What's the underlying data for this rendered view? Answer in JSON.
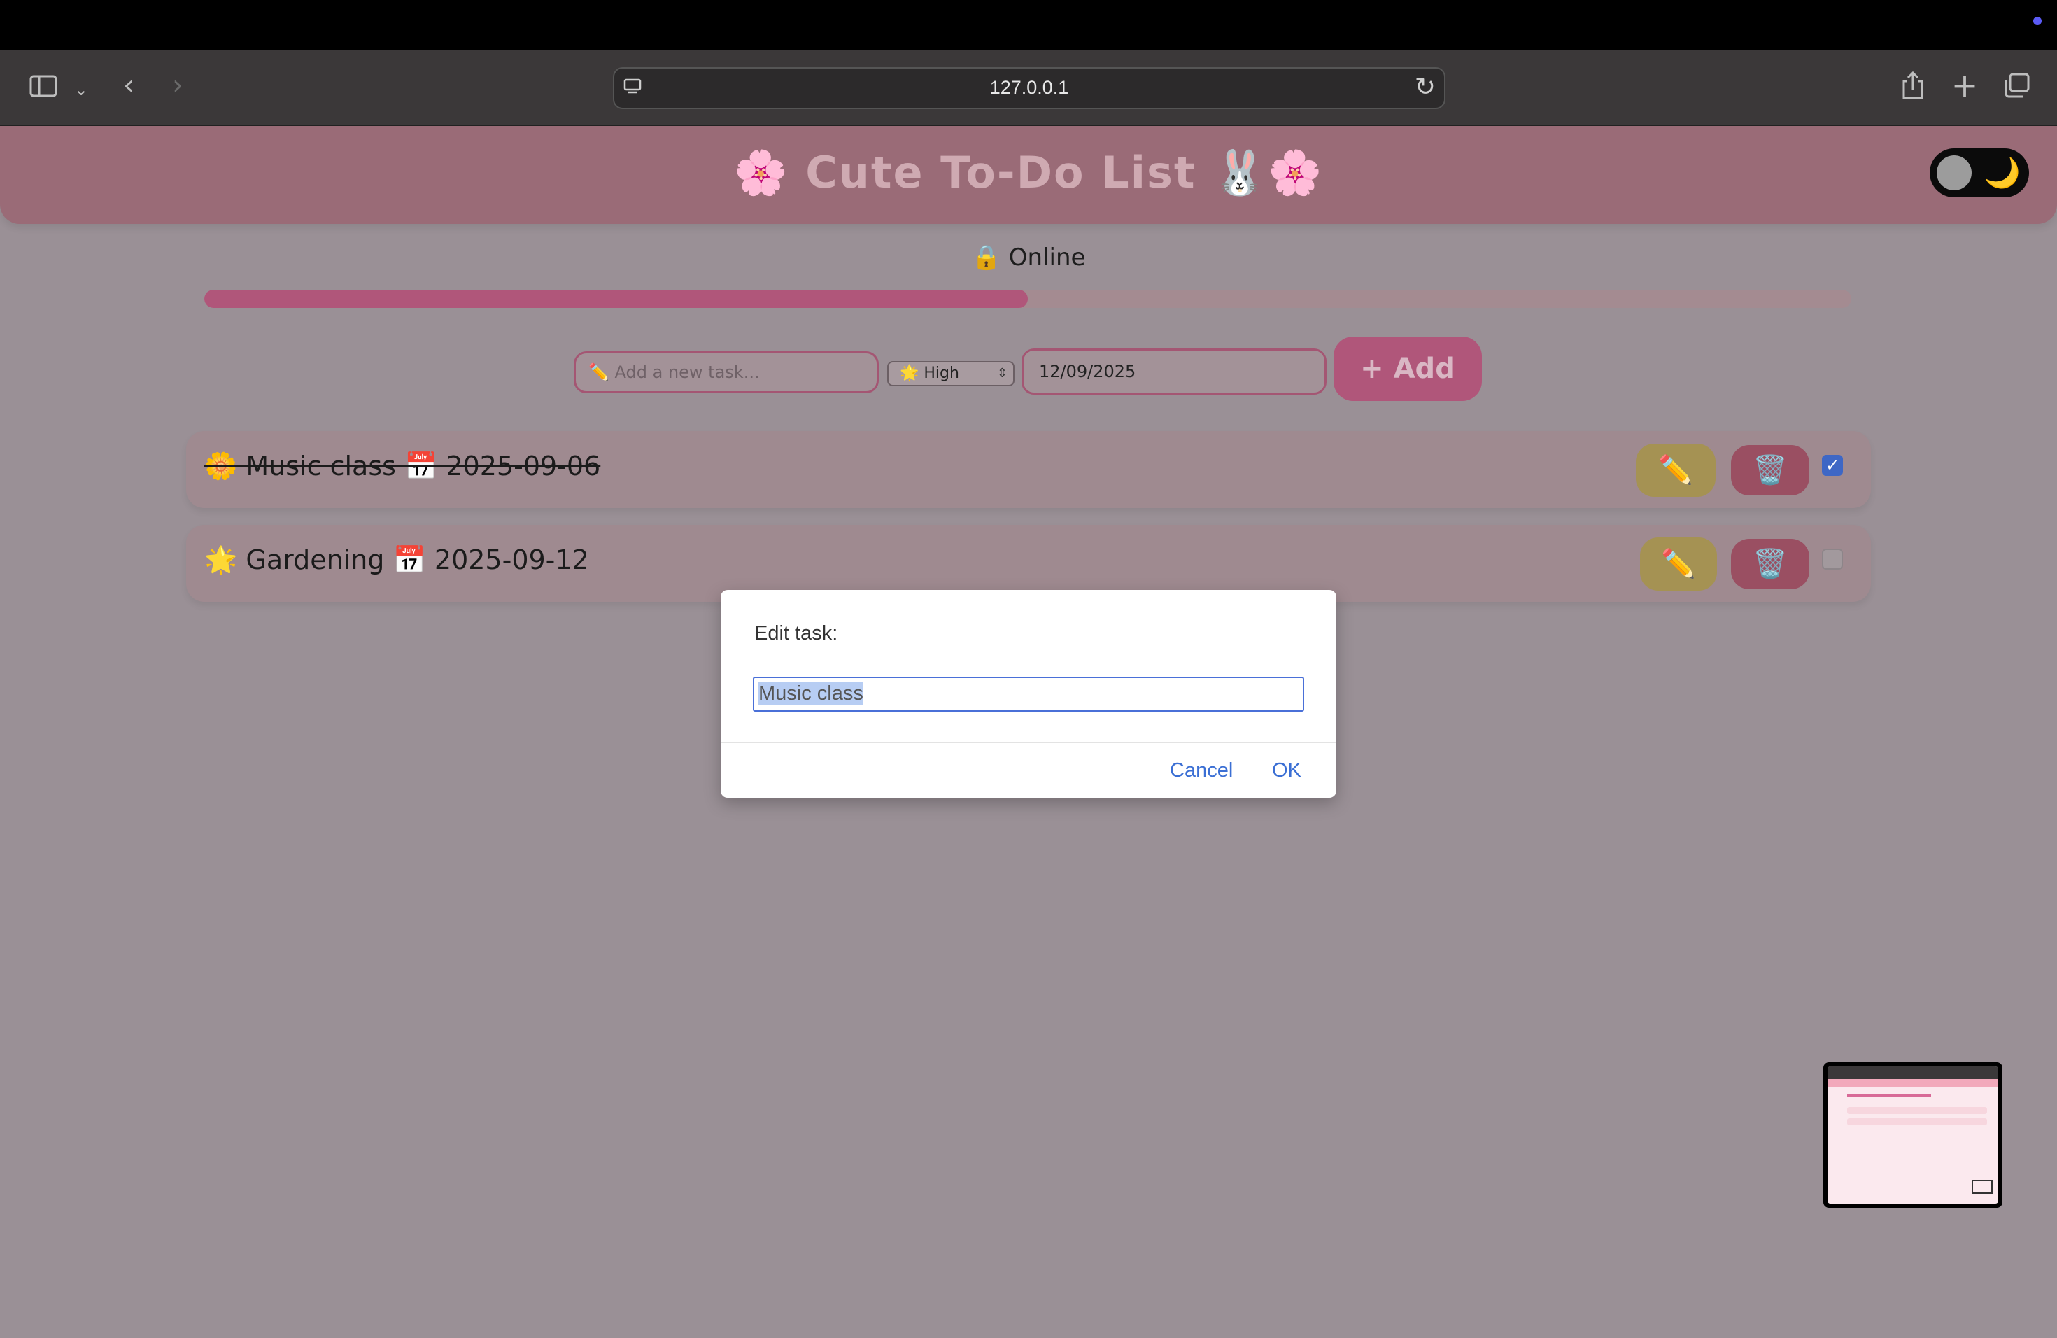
{
  "browser": {
    "url": "127.0.0.1"
  },
  "app": {
    "title": "🌸 Cute To-Do List 🐰🌸",
    "theme_toggle_icon": "🌙",
    "status": "🔒 Online",
    "progress_fraction": 0.5
  },
  "form": {
    "task_placeholder": "✏️ Add a new task...",
    "priority_value": "🌟 High",
    "date_value": "12/09/2025",
    "add_label": "+ Add"
  },
  "tasks": [
    {
      "icon": "🌼",
      "name": "Music class",
      "date_icon": "📅",
      "date": "2025-09-06",
      "text": "🌼 Music class 📅 2025-09-06",
      "done": true
    },
    {
      "icon": "🌟",
      "name": "Gardening",
      "date_icon": "📅",
      "date": "2025-09-12",
      "text": "🌟 Gardening 📅 2025-09-12",
      "done": false
    }
  ],
  "task_actions": {
    "edit_icon": "✏️",
    "delete_icon": "🗑️"
  },
  "dialog": {
    "prompt": "Edit task:",
    "field_value": "Music class",
    "cancel_label": "Cancel",
    "ok_label": "OK"
  },
  "colors": {
    "brand_pink": "#b0567a",
    "edit_yellow": "#a59253",
    "delete_red": "#9a4f62",
    "checkbox_blue": "#3e67c5",
    "link_blue": "#3b6fd4"
  }
}
